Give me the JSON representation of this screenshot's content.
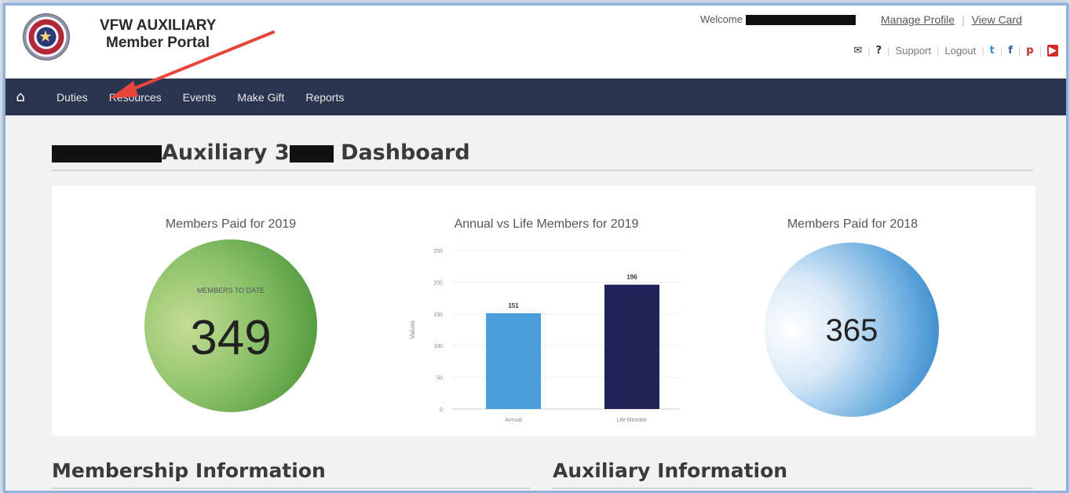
{
  "header": {
    "portal_line1": "VFW AUXILIARY",
    "portal_line2": "Member Portal",
    "welcome": "Welcome",
    "manage_profile": "Manage Profile",
    "view_card": "View Card",
    "support": "Support",
    "logout": "Logout"
  },
  "nav": {
    "items": [
      "Duties",
      "Resources",
      "Events",
      "Make Gift",
      "Reports"
    ]
  },
  "dashboard": {
    "title_mid": "Auxiliary 3",
    "title_end": "Dashboard"
  },
  "panels": {
    "left": {
      "title": "Members Paid for 2019",
      "label": "MEMBERS TO DATE",
      "value": "349"
    },
    "middle": {
      "title": "Annual vs Life Members for 2019"
    },
    "right": {
      "title": "Members Paid for 2018",
      "value": "365"
    }
  },
  "sections": {
    "membership": "Membership Information",
    "auxiliary": "Auxiliary Information"
  },
  "colors": {
    "nav_bg": "#2c3550",
    "bar_annual": "#4a9fdc",
    "bar_life": "#1f2358",
    "arrow": "#e8463a"
  },
  "chart_data": {
    "type": "bar",
    "categories": [
      "Annual",
      "Life Member"
    ],
    "values": [
      151,
      196
    ],
    "data_labels": [
      "151",
      "196"
    ],
    "ylabel": "Values",
    "ylim": [
      0,
      250
    ],
    "yticks": [
      "0",
      "50",
      "100",
      "150",
      "200",
      "250"
    ],
    "grid": true
  }
}
